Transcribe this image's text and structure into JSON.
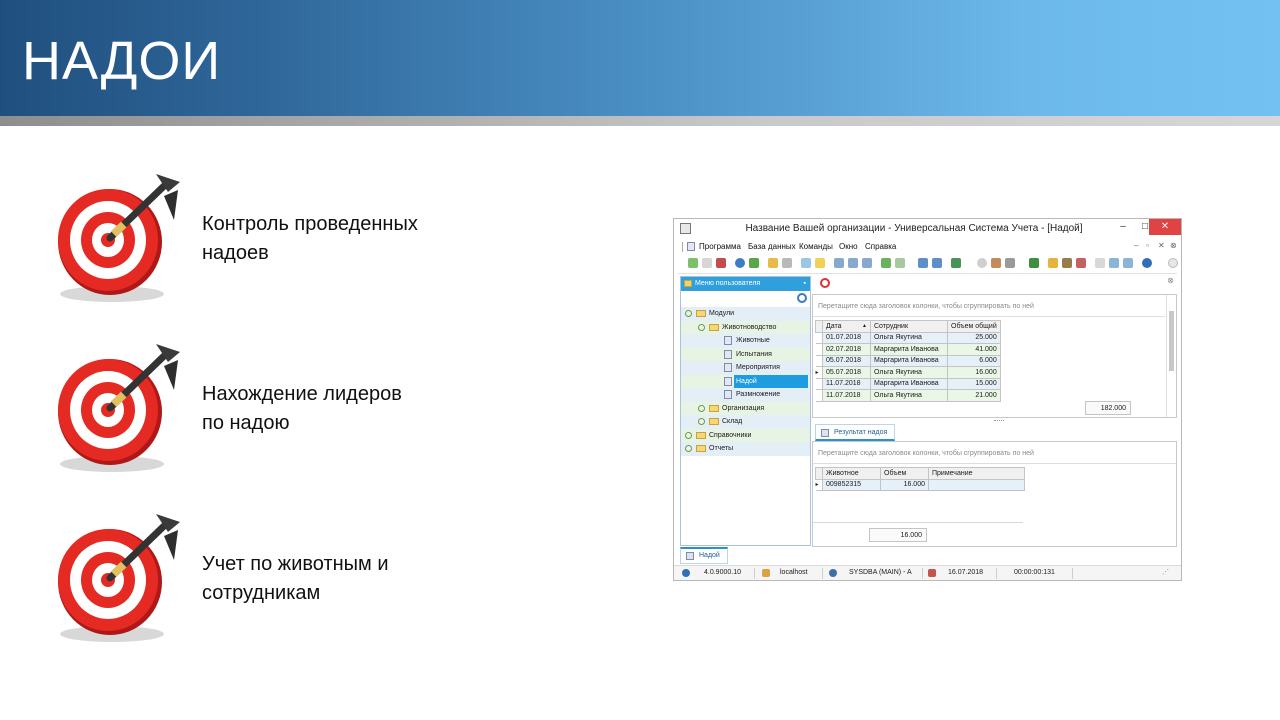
{
  "slide": {
    "title": "НАДОИ",
    "bullets": [
      {
        "text": "Контроль проведенных\nнадоев",
        "icon": "dart-target-icon"
      },
      {
        "text": "Нахождение лидеров\nпо надою",
        "icon": "dart-target-icon"
      },
      {
        "text": "Учет по животным и\nсотрудникам",
        "icon": "dart-target-icon"
      }
    ]
  },
  "app": {
    "window_title": "Название Вашей организации - Универсальная Система Учета - [Надой]",
    "menu": [
      "Программа",
      "База данных",
      "Команды",
      "Окно",
      "Справка"
    ],
    "left_panel": {
      "title": "Меню пользователя",
      "tree": [
        {
          "label": "Модули",
          "level": 0,
          "kind": "folder",
          "expanded": true
        },
        {
          "label": "Животноводство",
          "level": 1,
          "kind": "folder",
          "expanded": true
        },
        {
          "label": "Животные",
          "level": 2,
          "kind": "doc"
        },
        {
          "label": "Испытания",
          "level": 2,
          "kind": "doc"
        },
        {
          "label": "Мероприятия",
          "level": 2,
          "kind": "doc"
        },
        {
          "label": "Надой",
          "level": 2,
          "kind": "doc",
          "selected": true
        },
        {
          "label": "Размножение",
          "level": 2,
          "kind": "doc"
        },
        {
          "label": "Организация",
          "level": 1,
          "kind": "folder"
        },
        {
          "label": "Склад",
          "level": 1,
          "kind": "folder"
        },
        {
          "label": "Справочники",
          "level": 0,
          "kind": "folder"
        },
        {
          "label": "Отчеты",
          "level": 0,
          "kind": "folder"
        }
      ]
    },
    "grid_main": {
      "group_hint": "Перетащите сюда заголовок колонки, чтобы сгруппировать по ней",
      "columns": [
        "Дата",
        "Сотрудник",
        "Объем общий"
      ],
      "rows": [
        [
          "01.07.2018",
          "Ольга Якутина",
          "25.000"
        ],
        [
          "02.07.2018",
          "Маргарита Иванова",
          "41.000"
        ],
        [
          "05.07.2018",
          "Маргарита Иванова",
          "6.000"
        ],
        [
          "05.07.2018",
          "Ольга Якутина",
          "16.000"
        ],
        [
          "11.07.2018",
          "Маргарита Иванова",
          "15.000"
        ],
        [
          "11.07.2018",
          "Ольга Якутина",
          "21.000"
        ]
      ],
      "total": "182.000"
    },
    "detail_tab": "Результат надоя",
    "grid_detail": {
      "group_hint": "Перетащите сюда заголовок колонки, чтобы сгруппировать по ней",
      "columns": [
        "Животное",
        "Объем",
        "Примечание"
      ],
      "rows": [
        [
          "009852315",
          "16.000",
          ""
        ]
      ],
      "total": "16.000"
    },
    "bottom_tab": "Надой",
    "status": {
      "version": "4.0.9000.10",
      "server": "localhost",
      "user": "SYSDBA (MAIN) - A",
      "date": "16.07.2018",
      "timer": "00:00:00:131"
    },
    "colors": {
      "accent": "#1e9ce0",
      "row_green": "#eaf6e6",
      "row_blue": "#e6f0f8",
      "close": "#e04343"
    }
  }
}
